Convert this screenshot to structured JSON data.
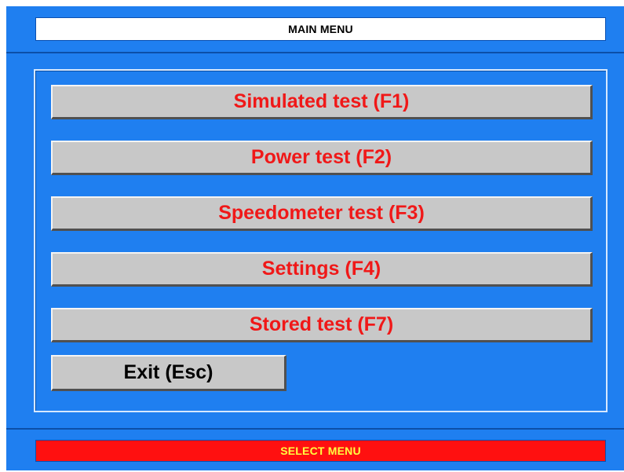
{
  "window": {
    "title": "MAIN MENU",
    "status": "SELECT MENU"
  },
  "menu": {
    "items": [
      {
        "label": "Simulated test (F1)"
      },
      {
        "label": "Power test (F2)"
      },
      {
        "label": "Speedometer test (F3)"
      },
      {
        "label": "Settings (F4)"
      },
      {
        "label": "Stored test (F7)"
      }
    ],
    "exit_label": "Exit (Esc)"
  },
  "colors": {
    "background": "#1f7ff0",
    "menu_text": "#f01818",
    "button_face": "#c8c8c8",
    "status_bg": "#ff1010",
    "status_text": "#ffff40"
  }
}
